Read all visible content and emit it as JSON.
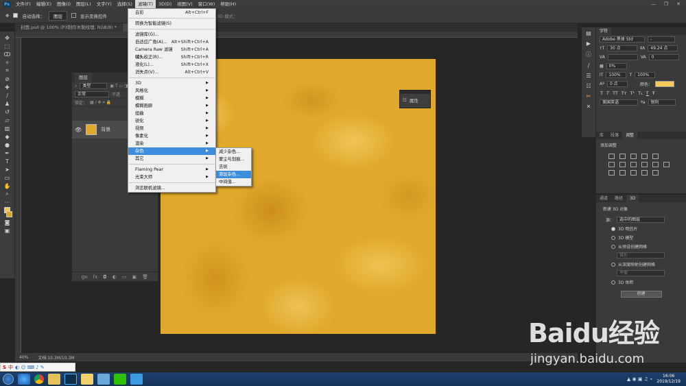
{
  "menubar": {
    "logo": "Ps",
    "items": [
      "文件(F)",
      "编辑(E)",
      "图像(I)",
      "图层(L)",
      "文字(Y)",
      "选择(S)",
      "滤镜(T)",
      "3D(D)",
      "视图(V)",
      "窗口(W)",
      "帮助(H)"
    ],
    "active_index": 6,
    "win_controls": [
      "—",
      "❐",
      "✕"
    ]
  },
  "options": {
    "auto_select_label": "自动选择：",
    "auto_select_value": "图层",
    "show_transform_label": "显示变换控件",
    "mode_3d_label": "3D 模式："
  },
  "doc_tabs": [
    {
      "title": "封面.psd @ 100% (P3制作木制纹理, RGB/8) *",
      "active": false
    },
    {
      "title": "未标...",
      "active": true
    }
  ],
  "filter_menu": {
    "items": [
      {
        "label": "云彩",
        "shortcut": "Alt+Ctrl+F"
      },
      {
        "sep": true
      },
      {
        "label": "转换为智能滤镜(S)"
      },
      {
        "sep": true
      },
      {
        "label": "滤镜库(G)..."
      },
      {
        "label": "自适应广角(A)...",
        "shortcut": "Alt+Shift+Ctrl+A"
      },
      {
        "label": "Camera Raw 滤镜(C)...",
        "shortcut": "Shift+Ctrl+A"
      },
      {
        "label": "镜头校正(R)...",
        "shortcut": "Shift+Ctrl+R"
      },
      {
        "label": "液化(L)...",
        "shortcut": "Shift+Ctrl+X"
      },
      {
        "label": "消失点(V)...",
        "shortcut": "Alt+Ctrl+V"
      },
      {
        "sep": true
      },
      {
        "label": "3D",
        "sub": true
      },
      {
        "label": "风格化",
        "sub": true
      },
      {
        "label": "模糊",
        "sub": true
      },
      {
        "label": "模糊画廊",
        "sub": true
      },
      {
        "label": "扭曲",
        "sub": true
      },
      {
        "label": "锐化",
        "sub": true
      },
      {
        "label": "视频",
        "sub": true
      },
      {
        "label": "像素化",
        "sub": true
      },
      {
        "label": "渲染",
        "sub": true
      },
      {
        "label": "杂色",
        "sub": true,
        "highlight": true
      },
      {
        "label": "其它",
        "sub": true
      },
      {
        "sep": true
      },
      {
        "label": "Flaming Pear",
        "sub": true
      },
      {
        "label": "光束大师",
        "sub": true
      },
      {
        "sep": true
      },
      {
        "label": "浏览联机滤镜..."
      }
    ]
  },
  "noise_menu": {
    "items": [
      {
        "label": "减少杂色..."
      },
      {
        "label": "蒙尘与划痕..."
      },
      {
        "label": "去斑"
      },
      {
        "label": "添加杂色...",
        "highlight": true
      },
      {
        "label": "中间值..."
      }
    ]
  },
  "layers_panel": {
    "tab": "图层",
    "kind_label": "类型",
    "blend_mode": "正常",
    "opacity_label": "不透",
    "lock_label": "锁定：",
    "fill_label": "填",
    "layer_name": "背景",
    "footer_icons": [
      "go",
      "fx",
      "◘",
      "◐",
      "▭",
      "▣",
      "🗑"
    ]
  },
  "properties_panel": {
    "label": "属性"
  },
  "char_panel": {
    "tabs": [
      "字符"
    ],
    "font": "Adobe 黑体 Std",
    "style": "-",
    "size": "30 点",
    "leading": "49.24 点",
    "kerning": "",
    "tracking": "0",
    "vscale": "0%",
    "hscale_a": "100%",
    "hscale_b": "100%",
    "baseline": "0 点",
    "color_label": "颜色：",
    "color": "#f7c95a",
    "type_buttons": [
      "T",
      "T",
      "TT",
      "Tт",
      "T¹",
      "T₁",
      "T",
      "Ŧ"
    ],
    "language": "美国英语",
    "antialias": "锐利"
  },
  "adj_panel": {
    "tabs": [
      "库",
      "段落",
      "调整"
    ],
    "active_tab": 2,
    "title": "添加调整"
  },
  "d3_panel": {
    "tabs": [
      "通道",
      "路径",
      "3D"
    ],
    "active_tab": 2,
    "title": "新建 3D 对象",
    "source_label": "源：",
    "source_value": "选中的图层",
    "options": [
      {
        "label": "3D 明信片",
        "on": true
      },
      {
        "label": "3D 模型",
        "on": false
      },
      {
        "label": "从预设创建网格",
        "on": false
      },
      {
        "label": "从深度映射创建网格",
        "on": false
      },
      {
        "label": "3D 体积",
        "on": false
      }
    ],
    "preset_value": "锥形",
    "depth_value": "平面",
    "create_button": "创建"
  },
  "statusbar": {
    "zoom": "40%",
    "doc_info": "文档:10.3M/10.3M"
  },
  "taskbar": {
    "ime": "中",
    "clock_time": "16:06",
    "clock_date": "2019/12/19"
  },
  "watermark": {
    "main": "Baidu经验",
    "sub": "jingyan.baidu.com"
  }
}
